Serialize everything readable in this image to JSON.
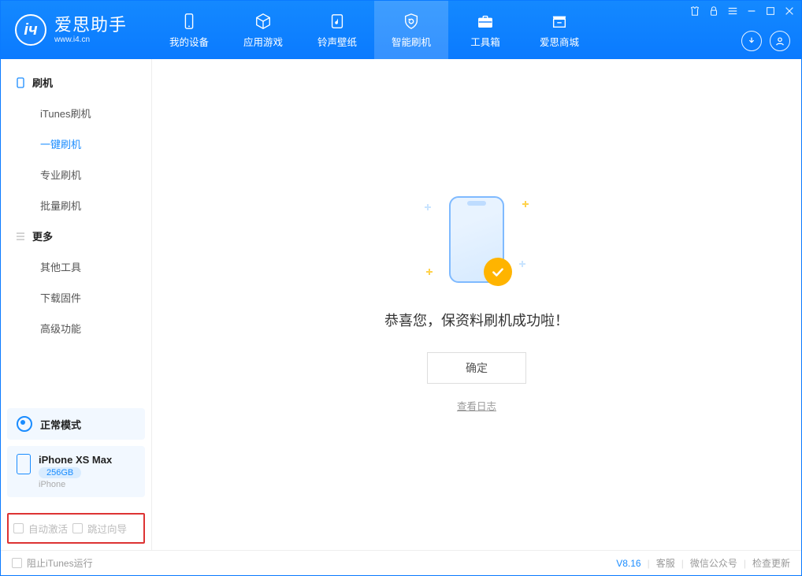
{
  "app": {
    "title": "爱思助手",
    "subtitle": "www.i4.cn"
  },
  "tabs": [
    {
      "label": "我的设备"
    },
    {
      "label": "应用游戏"
    },
    {
      "label": "铃声壁纸"
    },
    {
      "label": "智能刷机"
    },
    {
      "label": "工具箱"
    },
    {
      "label": "爱思商城"
    }
  ],
  "sidebar": {
    "group1": {
      "title": "刷机",
      "items": [
        "iTunes刷机",
        "一键刷机",
        "专业刷机",
        "批量刷机"
      ]
    },
    "group2": {
      "title": "更多",
      "items": [
        "其他工具",
        "下载固件",
        "高级功能"
      ]
    }
  },
  "mode": {
    "label": "正常模式"
  },
  "device": {
    "name": "iPhone XS Max",
    "capacity": "256GB",
    "type": "iPhone"
  },
  "checkboxes": {
    "auto_activate": "自动激活",
    "skip_guide": "跳过向导"
  },
  "main": {
    "success_message": "恭喜您，保资料刷机成功啦！",
    "ok_button": "确定",
    "view_log": "查看日志"
  },
  "footer": {
    "block_itunes": "阻止iTunes运行",
    "version": "V8.16",
    "support": "客服",
    "wechat": "微信公众号",
    "update": "检查更新"
  }
}
